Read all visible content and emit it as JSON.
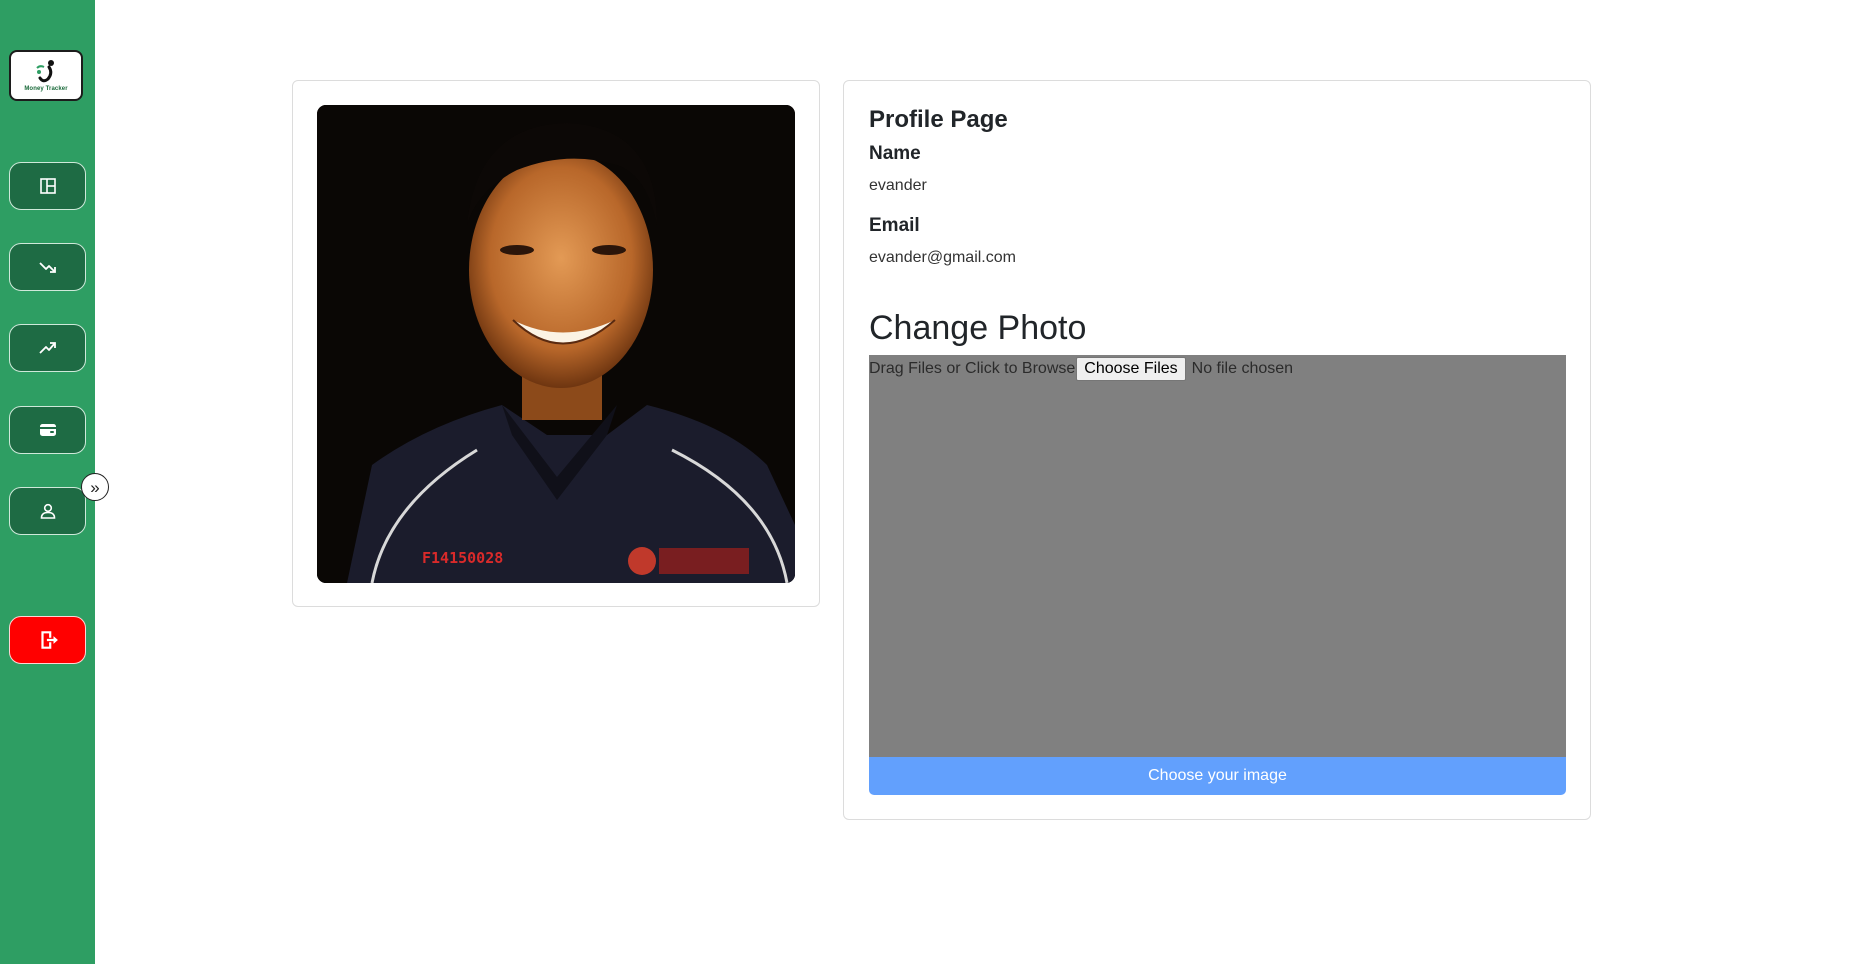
{
  "sidebar": {
    "logo_text": "Money Tracker",
    "nav": [
      {
        "name": "dashboard",
        "icon": "layout-icon"
      },
      {
        "name": "expense",
        "icon": "trending-down-icon"
      },
      {
        "name": "income",
        "icon": "trending-up-icon"
      },
      {
        "name": "wallet",
        "icon": "wallet-icon"
      },
      {
        "name": "profile",
        "icon": "user-icon"
      }
    ],
    "expand_label": "»",
    "logout_icon": "logout-icon"
  },
  "profile": {
    "title": "Profile Page",
    "name_label": "Name",
    "name_value": "evander",
    "email_label": "Email",
    "email_value": "evander@gmail.com"
  },
  "change_photo": {
    "title": "Change Photo",
    "dropzone_text": "Drag Files or Click to Browse",
    "choose_files_label": "Choose Files",
    "no_file_text": "No file chosen",
    "submit_label": "Choose your image"
  },
  "colors": {
    "sidebar_bg": "#2e9e63",
    "nav_btn_bg": "#1e6b44",
    "logout_bg": "#ff0000",
    "dropzone_bg": "#808080",
    "button_bg": "#62a0fd"
  }
}
